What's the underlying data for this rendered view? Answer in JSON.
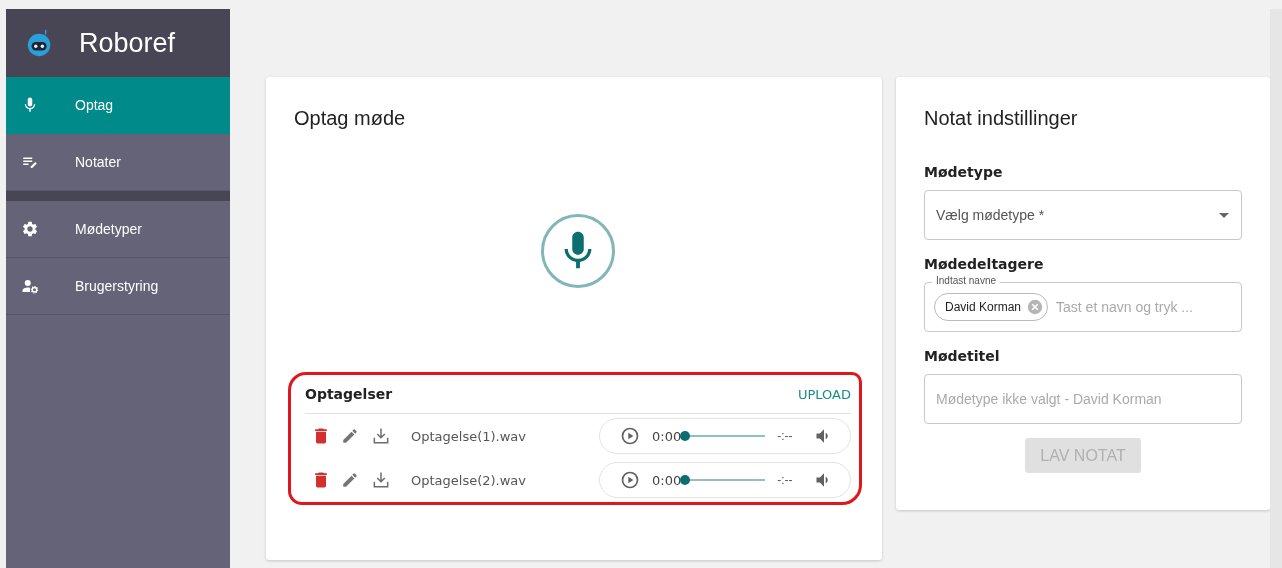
{
  "app": {
    "name": "Roboref"
  },
  "sidebar": {
    "groups": [
      [
        {
          "label": "Optag",
          "kind": "mic",
          "selected": true
        },
        {
          "label": "Notater",
          "kind": "notes",
          "selected": false
        }
      ],
      [
        {
          "label": "Mødetyper",
          "kind": "gear",
          "selected": false
        },
        {
          "label": "Brugerstyring",
          "kind": "user-gear",
          "selected": false
        }
      ]
    ]
  },
  "record_card": {
    "title": "Optag møde",
    "recordings": {
      "title": "Optagelser",
      "highlighted": true,
      "action": "UPLOAD",
      "items": [
        {
          "file": "Optagelse(1).wav",
          "time": "0:00",
          "duration": "-:--",
          "level": 0
        },
        {
          "file": "Optagelse(2).wav",
          "time": "0:00",
          "duration": "-:--",
          "level": 0
        }
      ]
    }
  },
  "settings_card": {
    "title": "Notat indstillinger",
    "fields": [
      {
        "kind": "select",
        "label": "Mødetype",
        "placeholder": "Vælg mødetype *"
      },
      {
        "kind": "chips",
        "label": "Mødedeltagere",
        "legend": "Indtast navne",
        "chips": [
          "David Korman"
        ],
        "placeholder": "Tast et navn og tryk ..."
      },
      {
        "kind": "text",
        "label": "Mødetitel",
        "placeholder": "Mødetype ikke valgt - David Korman"
      }
    ],
    "button": {
      "label": "LAV NOTAT",
      "disabled": true
    }
  }
}
